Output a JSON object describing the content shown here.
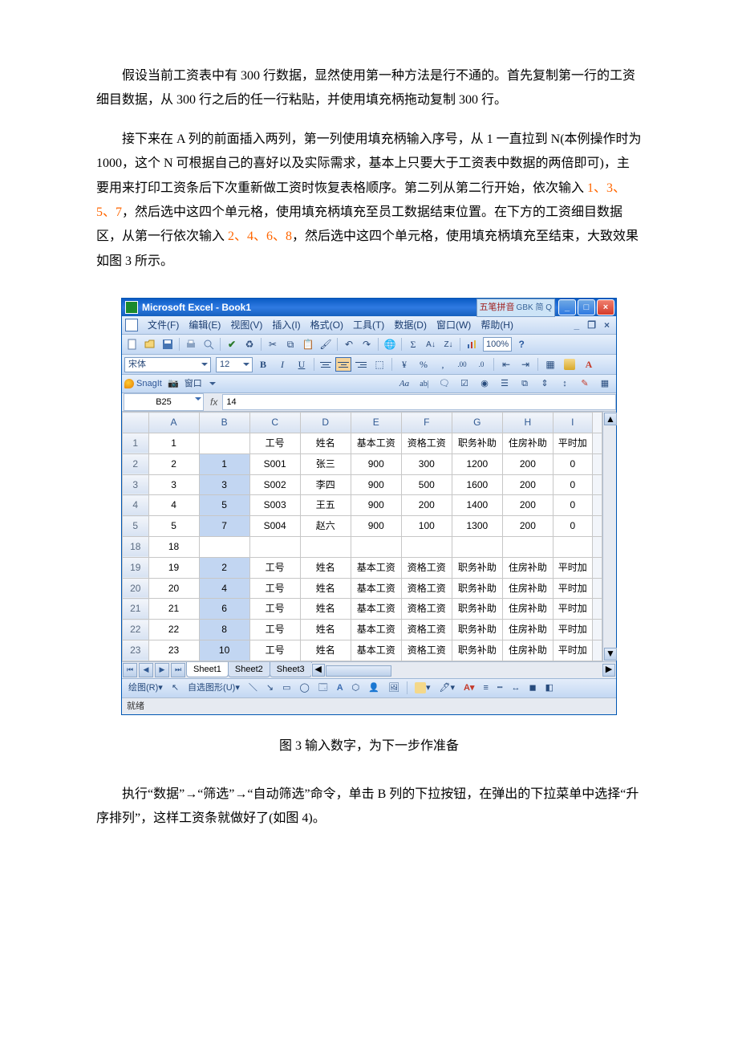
{
  "para1_a": "假设当前工资表中有 300 行数据，显然使用第一种方法是行不通的。首先复制第一行的工资细目数据，从 300 行之后的任一行粘贴，并使用填充柄拖动复制 300 行。",
  "para2_a": "接下来在 A 列的前面插入两列，第一列使用填充柄输入序号，从 1 一直拉到 N(本例操作时为 1000，这个 N 可根据自己的喜好以及实际需求，基本上只要大于工资表中数据的两倍即可)，主要用来打印工资条后下次重新做工资时恢复表格顺序。第二列从第二行开始，依次输入 ",
  "para2_n1": "1、3、5、7",
  "para2_b": "，然后选中这四个单元格，使用填充柄填充至员工数据结束位置。在下方的工资细目数据区，从第一行依次输入 ",
  "para2_n2": "2、4、6、8",
  "para2_c": "，然后选中这四个单元格，使用填充柄填充至结束，大致效果如图 3 所示。",
  "caption": "图 3 输入数字，为下一步作准备",
  "para3": "执行“数据”→“筛选”→“自动筛选”命令，单击 B 列的下拉按钮，在弹出的下拉菜单中选择“升序排列”，这样工资条就做好了(如图 4)。",
  "excel": {
    "title": "Microsoft Excel - Book1",
    "ime": "五笔拼音",
    "ime_sub": "GBK 简 Q",
    "menu": [
      "文件(F)",
      "编辑(E)",
      "视图(V)",
      "插入(I)",
      "格式(O)",
      "工具(T)",
      "数据(D)",
      "窗口(W)",
      "帮助(H)"
    ],
    "zoom": "100%",
    "font": "宋体",
    "size": "12",
    "snag": "SnagIt",
    "snag_win": "窗口",
    "name": "B25",
    "formula": "14",
    "status": "就绪",
    "draw": "绘图(R)",
    "autoshape": "自选图形(U)",
    "tabs": [
      "Sheet1",
      "Sheet2",
      "Sheet3"
    ],
    "cols": [
      "A",
      "B",
      "C",
      "D",
      "E",
      "F",
      "G",
      "H",
      "I"
    ],
    "header_row": [
      "工号",
      "姓名",
      "基本工资",
      "资格工资",
      "职务补助",
      "住房补助",
      "平时加"
    ],
    "rows": [
      {
        "rn": "1",
        "a": "1",
        "b": "",
        "vals": [
          "工号",
          "姓名",
          "基本工资",
          "资格工资",
          "职务补助",
          "住房补助",
          "平时加"
        ]
      },
      {
        "rn": "2",
        "a": "2",
        "b": "1",
        "vals": [
          "S001",
          "张三",
          "900",
          "300",
          "1200",
          "200",
          "0"
        ]
      },
      {
        "rn": "3",
        "a": "3",
        "b": "3",
        "vals": [
          "S002",
          "李四",
          "900",
          "500",
          "1600",
          "200",
          "0"
        ]
      },
      {
        "rn": "4",
        "a": "4",
        "b": "5",
        "vals": [
          "S003",
          "王五",
          "900",
          "200",
          "1400",
          "200",
          "0"
        ]
      },
      {
        "rn": "5",
        "a": "5",
        "b": "7",
        "vals": [
          "S004",
          "赵六",
          "900",
          "100",
          "1300",
          "200",
          "0"
        ]
      },
      {
        "rn": "18",
        "a": "18",
        "b": "",
        "vals": [
          "",
          "",
          "",
          "",
          "",
          "",
          ""
        ]
      },
      {
        "rn": "19",
        "a": "19",
        "b": "2",
        "vals": [
          "工号",
          "姓名",
          "基本工资",
          "资格工资",
          "职务补助",
          "住房补助",
          "平时加"
        ]
      },
      {
        "rn": "20",
        "a": "20",
        "b": "4",
        "vals": [
          "工号",
          "姓名",
          "基本工资",
          "资格工资",
          "职务补助",
          "住房补助",
          "平时加"
        ]
      },
      {
        "rn": "21",
        "a": "21",
        "b": "6",
        "vals": [
          "工号",
          "姓名",
          "基本工资",
          "资格工资",
          "职务补助",
          "住房补助",
          "平时加"
        ]
      },
      {
        "rn": "22",
        "a": "22",
        "b": "8",
        "vals": [
          "工号",
          "姓名",
          "基本工资",
          "资格工资",
          "职务补助",
          "住房补助",
          "平时加"
        ]
      },
      {
        "rn": "23",
        "a": "23",
        "b": "10",
        "vals": [
          "工号",
          "姓名",
          "基本工资",
          "资格工资",
          "职务补助",
          "住房补助",
          "平时加"
        ]
      }
    ]
  }
}
